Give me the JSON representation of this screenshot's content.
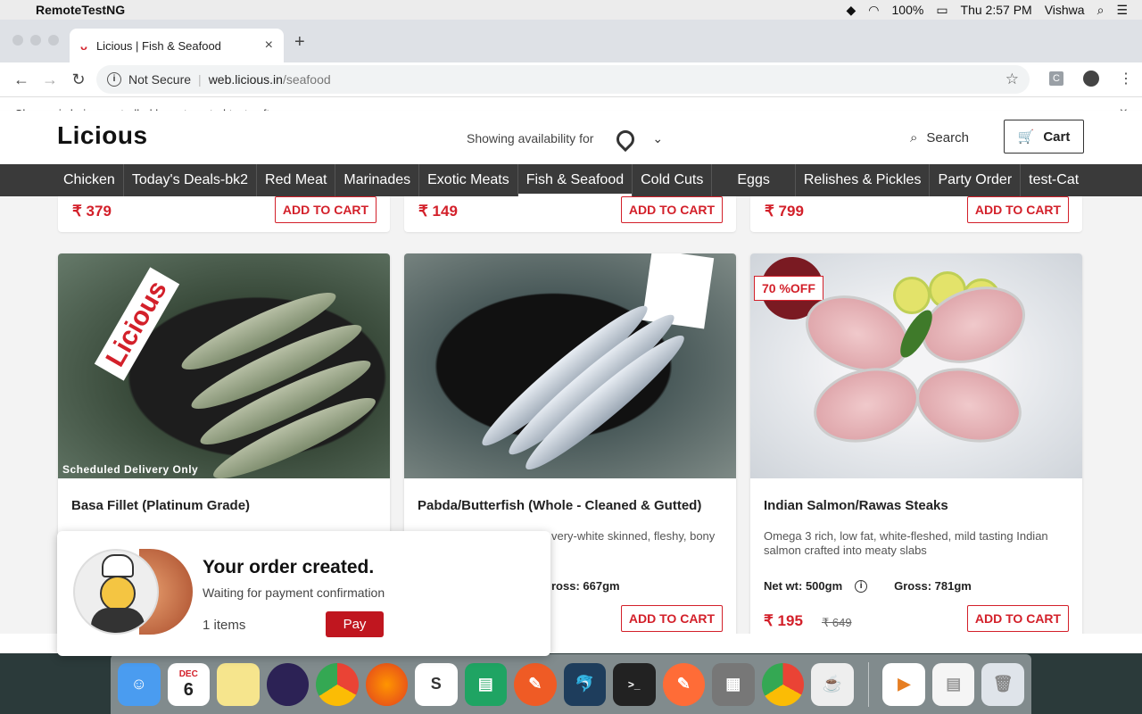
{
  "menubar": {
    "app_name": "RemoteTestNG",
    "battery": "100%",
    "clock": "Thu 2:57 PM",
    "user": "Vishwa",
    "icons": [
      "apple-icon",
      "shield-icon",
      "wifi-icon",
      "battery-icon",
      "search-icon",
      "list-icon"
    ]
  },
  "browser": {
    "tab_title": "Licious | Fish & Seafood",
    "tab_favicon": "ᴗ",
    "security_label": "Not Secure",
    "url_host": "web.licious.in",
    "url_path": "/seafood",
    "extension_label": "C",
    "infobar_text": "Chrome is being controlled by automated test software."
  },
  "header": {
    "logo": "Licious",
    "availability_label": "Showing availability for",
    "search_label": "Search",
    "cart_label": "Cart"
  },
  "categories": [
    {
      "label": "Chicken"
    },
    {
      "label": "Today's Deals-bk2"
    },
    {
      "label": "Red Meat"
    },
    {
      "label": "Marinades"
    },
    {
      "label": "Exotic Meats"
    },
    {
      "label": "Fish & Seafood"
    },
    {
      "label": "Cold Cuts"
    },
    {
      "label": "Eggs"
    },
    {
      "label": "Relishes & Pickles"
    },
    {
      "label": "Party Order"
    },
    {
      "label": "test-Cat"
    }
  ],
  "add_to_cart_label": "ADD TO CART",
  "top_row": [
    {
      "price": "₹ 379"
    },
    {
      "price": "₹ 149"
    },
    {
      "price": "₹ 799"
    }
  ],
  "products": [
    {
      "name": "Basa Fillet (Platinum Grade)",
      "image_caption": "Scheduled Delivery Only",
      "watermark": "Licious",
      "description": "",
      "net_wt": "",
      "gross": "",
      "price": "",
      "mrp": ""
    },
    {
      "name": "Pabda/Butterfish (Whole - Cleaned & Gutted)",
      "description": "very-white skinned, fleshy, bony",
      "gross": "ross: 667gm",
      "price": "",
      "mrp": ""
    },
    {
      "name": "Indian Salmon/Rawas Steaks",
      "badge": "70 %OFF",
      "description": "Omega 3 rich, low fat, white-fleshed, mild tasting Indian salmon crafted into meaty slabs",
      "net_wt": "Net wt: 500gm",
      "gross": "Gross: 781gm",
      "price": "₹ 195",
      "mrp": "₹ 649"
    }
  ],
  "order_toast": {
    "title": "Your order created.",
    "subtitle": "Waiting for payment confirmation",
    "items": "1 items",
    "pay_label": "Pay"
  },
  "dock": {
    "calendar_month": "DEC",
    "calendar_day": "6",
    "apps": [
      "finder-icon",
      "calendar-icon",
      "notes-icon",
      "eclipse-icon",
      "chrome-icon",
      "firefox-icon",
      "slack-icon",
      "sheets-icon",
      "postman-icon",
      "mysql-icon",
      "terminal-icon",
      "postman-orange-icon",
      "calculator-icon",
      "chrome-icon",
      "java-icon",
      "file-icon",
      "screenshot-icon",
      "trash-icon"
    ]
  }
}
